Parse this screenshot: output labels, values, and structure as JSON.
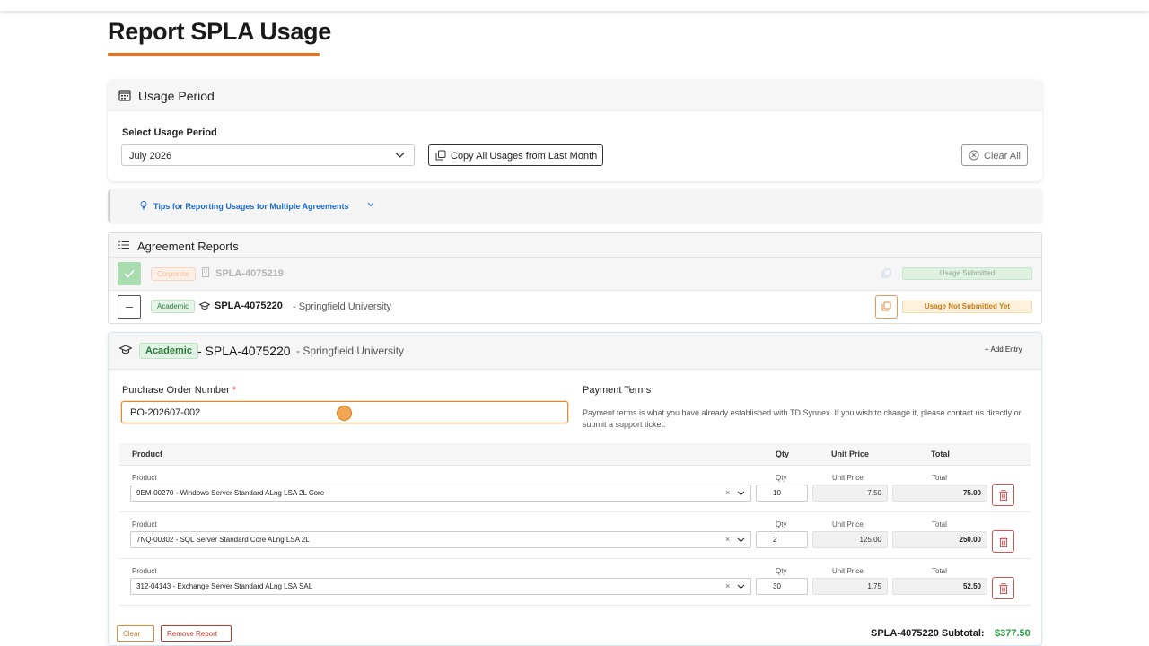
{
  "page": {
    "title": "Report SPLA Usage"
  },
  "usage_period": {
    "heading": "Usage Period",
    "select_label": "Select Usage Period",
    "selected_value": "July 2026",
    "copy_button": "Copy All Usages from Last Month",
    "clear_all_button": "Clear All"
  },
  "tips": {
    "label": "Tips for Reporting Usages for Multiple Agreements"
  },
  "agreement_reports": {
    "heading": "Agreement Reports",
    "items": [
      {
        "type": "Corporate",
        "number": "SPLA-4075219",
        "org": "",
        "status": "Usage Submitted"
      },
      {
        "type": "Academic",
        "number": "SPLA-4075220",
        "org": "- Springfield University",
        "status": "Usage Not Submitted Yet"
      }
    ]
  },
  "report": {
    "type": "Academic",
    "number": "- SPLA-4075220",
    "org": "- Springfield University",
    "add_entry": "+ Add Entry",
    "po_label": "Purchase Order Number",
    "po_required": "*",
    "po_value": "PO-202607-002",
    "payment_terms_label": "Payment Terms",
    "payment_terms_text": "Payment terms is what you have already established with TD Synnex. If you wish to change it, please contact us directly or submit a support ticket.",
    "table": {
      "headers": {
        "product": "Product",
        "qty": "Qty",
        "unit_price": "Unit Price",
        "total": "Total"
      },
      "row_labels": {
        "product": "Product",
        "qty": "Qty",
        "unit_price": "Unit Price",
        "total": "Total"
      },
      "rows": [
        {
          "product": "9EM-00270 - Windows Server Standard ALng LSA 2L Core",
          "qty": "10",
          "unit_price": "7.50",
          "total": "75.00"
        },
        {
          "product": "7NQ-00302 - SQL Server Standard Core ALng LSA 2L",
          "qty": "2",
          "unit_price": "125.00",
          "total": "250.00"
        },
        {
          "product": "312-04143 - Exchange Server Standard ALng LSA SAL",
          "qty": "30",
          "unit_price": "1.75",
          "total": "52.50"
        }
      ]
    },
    "clear_button": "Clear",
    "remove_button": "Remove Report",
    "subtotal_label": "SPLA-4075220 Subtotal:",
    "subtotal_value": "$377.50"
  },
  "colors": {
    "accent": "#e8731a",
    "link": "#1a6bd0",
    "success": "#2e9e44",
    "danger": "#c0392b"
  }
}
